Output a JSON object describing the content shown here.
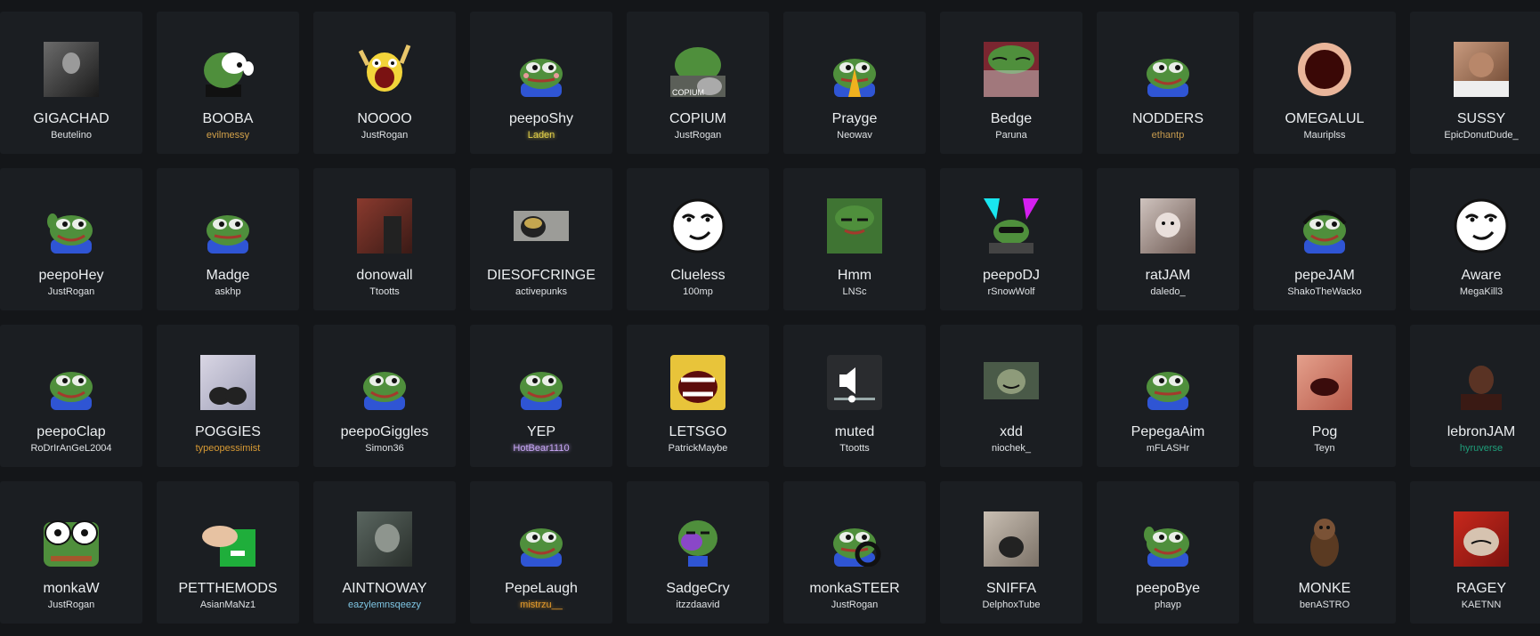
{
  "emotes": [
    {
      "name": "GIGACHAD",
      "author": "Beutelino",
      "icon": "gigachad-icon"
    },
    {
      "name": "BOOBA",
      "author": "evilmessy",
      "author_color": "#d4a24a",
      "icon": "booba-icon"
    },
    {
      "name": "NOOOO",
      "author": "JustRogan",
      "icon": "noooo-icon"
    },
    {
      "name": "peepoShy",
      "author": "Laden",
      "author_color": "#e5d24a",
      "author_glow": true,
      "icon": "peeposhy-icon"
    },
    {
      "name": "COPIUM",
      "author": "JustRogan",
      "icon": "copium-icon"
    },
    {
      "name": "Prayge",
      "author": "Neowav",
      "icon": "prayge-icon"
    },
    {
      "name": "Bedge",
      "author": "Paruna",
      "icon": "bedge-icon"
    },
    {
      "name": "NODDERS",
      "author": "ethantp",
      "author_color": "#c69a4e",
      "icon": "nodders-icon"
    },
    {
      "name": "OMEGALUL",
      "author": "Mauriplss",
      "icon": "omegalul-icon"
    },
    {
      "name": "SUSSY",
      "author": "EpicDonutDude_",
      "icon": "sussy-icon"
    },
    {
      "name": "peepoHey",
      "author": "JustRogan",
      "icon": "peepohey-icon"
    },
    {
      "name": "Madge",
      "author": "askhp",
      "icon": "madge-icon"
    },
    {
      "name": "donowall",
      "author": "Ttootts",
      "icon": "donowall-icon"
    },
    {
      "name": "DIESOFCRINGE",
      "author": "activepunks",
      "icon": "diesofcringe-icon"
    },
    {
      "name": "Clueless",
      "author": "100mp",
      "icon": "clueless-icon"
    },
    {
      "name": "Hmm",
      "author": "LNSc",
      "icon": "hmm-icon"
    },
    {
      "name": "peepoDJ",
      "author": "rSnowWolf",
      "icon": "peepodj-icon"
    },
    {
      "name": "ratJAM",
      "author": "daledo_",
      "icon": "ratjam-icon"
    },
    {
      "name": "pepeJAM",
      "author": "ShakoTheWacko",
      "icon": "pepejam-icon"
    },
    {
      "name": "Aware",
      "author": "MegaKill3",
      "icon": "aware-icon"
    },
    {
      "name": "peepoClap",
      "author": "RoDrIrAnGeL2004",
      "icon": "peepoclap-icon"
    },
    {
      "name": "POGGIES",
      "author": "typeopessimist",
      "author_color": "#d79a34",
      "icon": "poggies-icon"
    },
    {
      "name": "peepoGiggles",
      "author": "Simon36",
      "icon": "peepogiggles-icon"
    },
    {
      "name": "YEP",
      "author": "HotBear1110",
      "author_color": "#c7a6f5",
      "author_glow": true,
      "icon": "yep-icon"
    },
    {
      "name": "LETSGO",
      "author": "PatrickMaybe",
      "icon": "letsgo-icon"
    },
    {
      "name": "muted",
      "author": "Ttootts",
      "icon": "muted-icon"
    },
    {
      "name": "xdd",
      "author": "niochek_",
      "icon": "xdd-icon"
    },
    {
      "name": "PepegaAim",
      "author": "mFLASHr",
      "icon": "pepegaaim-icon"
    },
    {
      "name": "Pog",
      "author": "Teyn",
      "icon": "pog-icon"
    },
    {
      "name": "lebronJAM",
      "author": "hyruverse",
      "author_color": "#1f9e7a",
      "icon": "lebronjam-icon"
    },
    {
      "name": "monkaW",
      "author": "JustRogan",
      "icon": "monkaw-icon"
    },
    {
      "name": "PETTHEMODS",
      "author": "AsianMaNz1",
      "icon": "pethemods-icon"
    },
    {
      "name": "AINTNOWAY",
      "author": "eazylemnsqeezy",
      "author_color": "#7fc6e4",
      "icon": "aintnoway-icon"
    },
    {
      "name": "PepeLaugh",
      "author": "mistrzu__",
      "author_color": "#e39a2b",
      "author_glow": true,
      "icon": "pepelaugh-icon"
    },
    {
      "name": "SadgeCry",
      "author": "itzzdaavid",
      "icon": "sadgecry-icon"
    },
    {
      "name": "monkaSTEER",
      "author": "JustRogan",
      "icon": "monkasteer-icon"
    },
    {
      "name": "SNIFFA",
      "author": "DelphoxTube",
      "icon": "sniffa-icon"
    },
    {
      "name": "peepoBye",
      "author": "phayp",
      "icon": "peepobye-icon"
    },
    {
      "name": "MONKE",
      "author": "benASTRO",
      "icon": "monke-icon"
    },
    {
      "name": "RAGEY",
      "author": "KAETNN",
      "icon": "ragey-icon"
    }
  ]
}
